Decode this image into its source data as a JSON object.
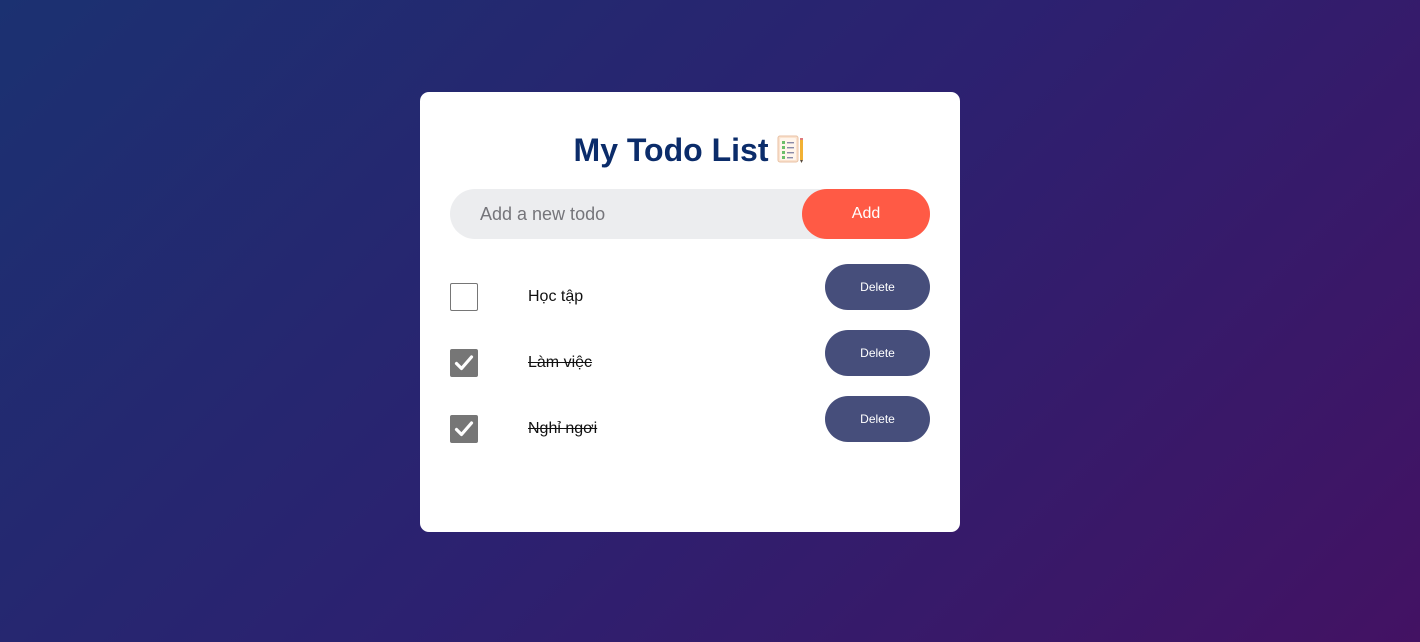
{
  "app": {
    "title": "My Todo List",
    "title_icon": "notepad-checklist-icon"
  },
  "new_todo": {
    "placeholder": "Add a new todo",
    "value": "",
    "add_label": "Add"
  },
  "todos": [
    {
      "text": "Học tập",
      "completed": false,
      "delete_label": "Delete"
    },
    {
      "text": "Làm việc",
      "completed": true,
      "delete_label": "Delete"
    },
    {
      "text": "Nghỉ ngơi",
      "completed": true,
      "delete_label": "Delete"
    }
  ],
  "colors": {
    "background_start": "#1b3171",
    "background_end": "#431263",
    "title": "#0b2c6a",
    "add_button": "#ff5a45",
    "delete_button": "#464e7b",
    "checkbox_checked": "#767676"
  }
}
